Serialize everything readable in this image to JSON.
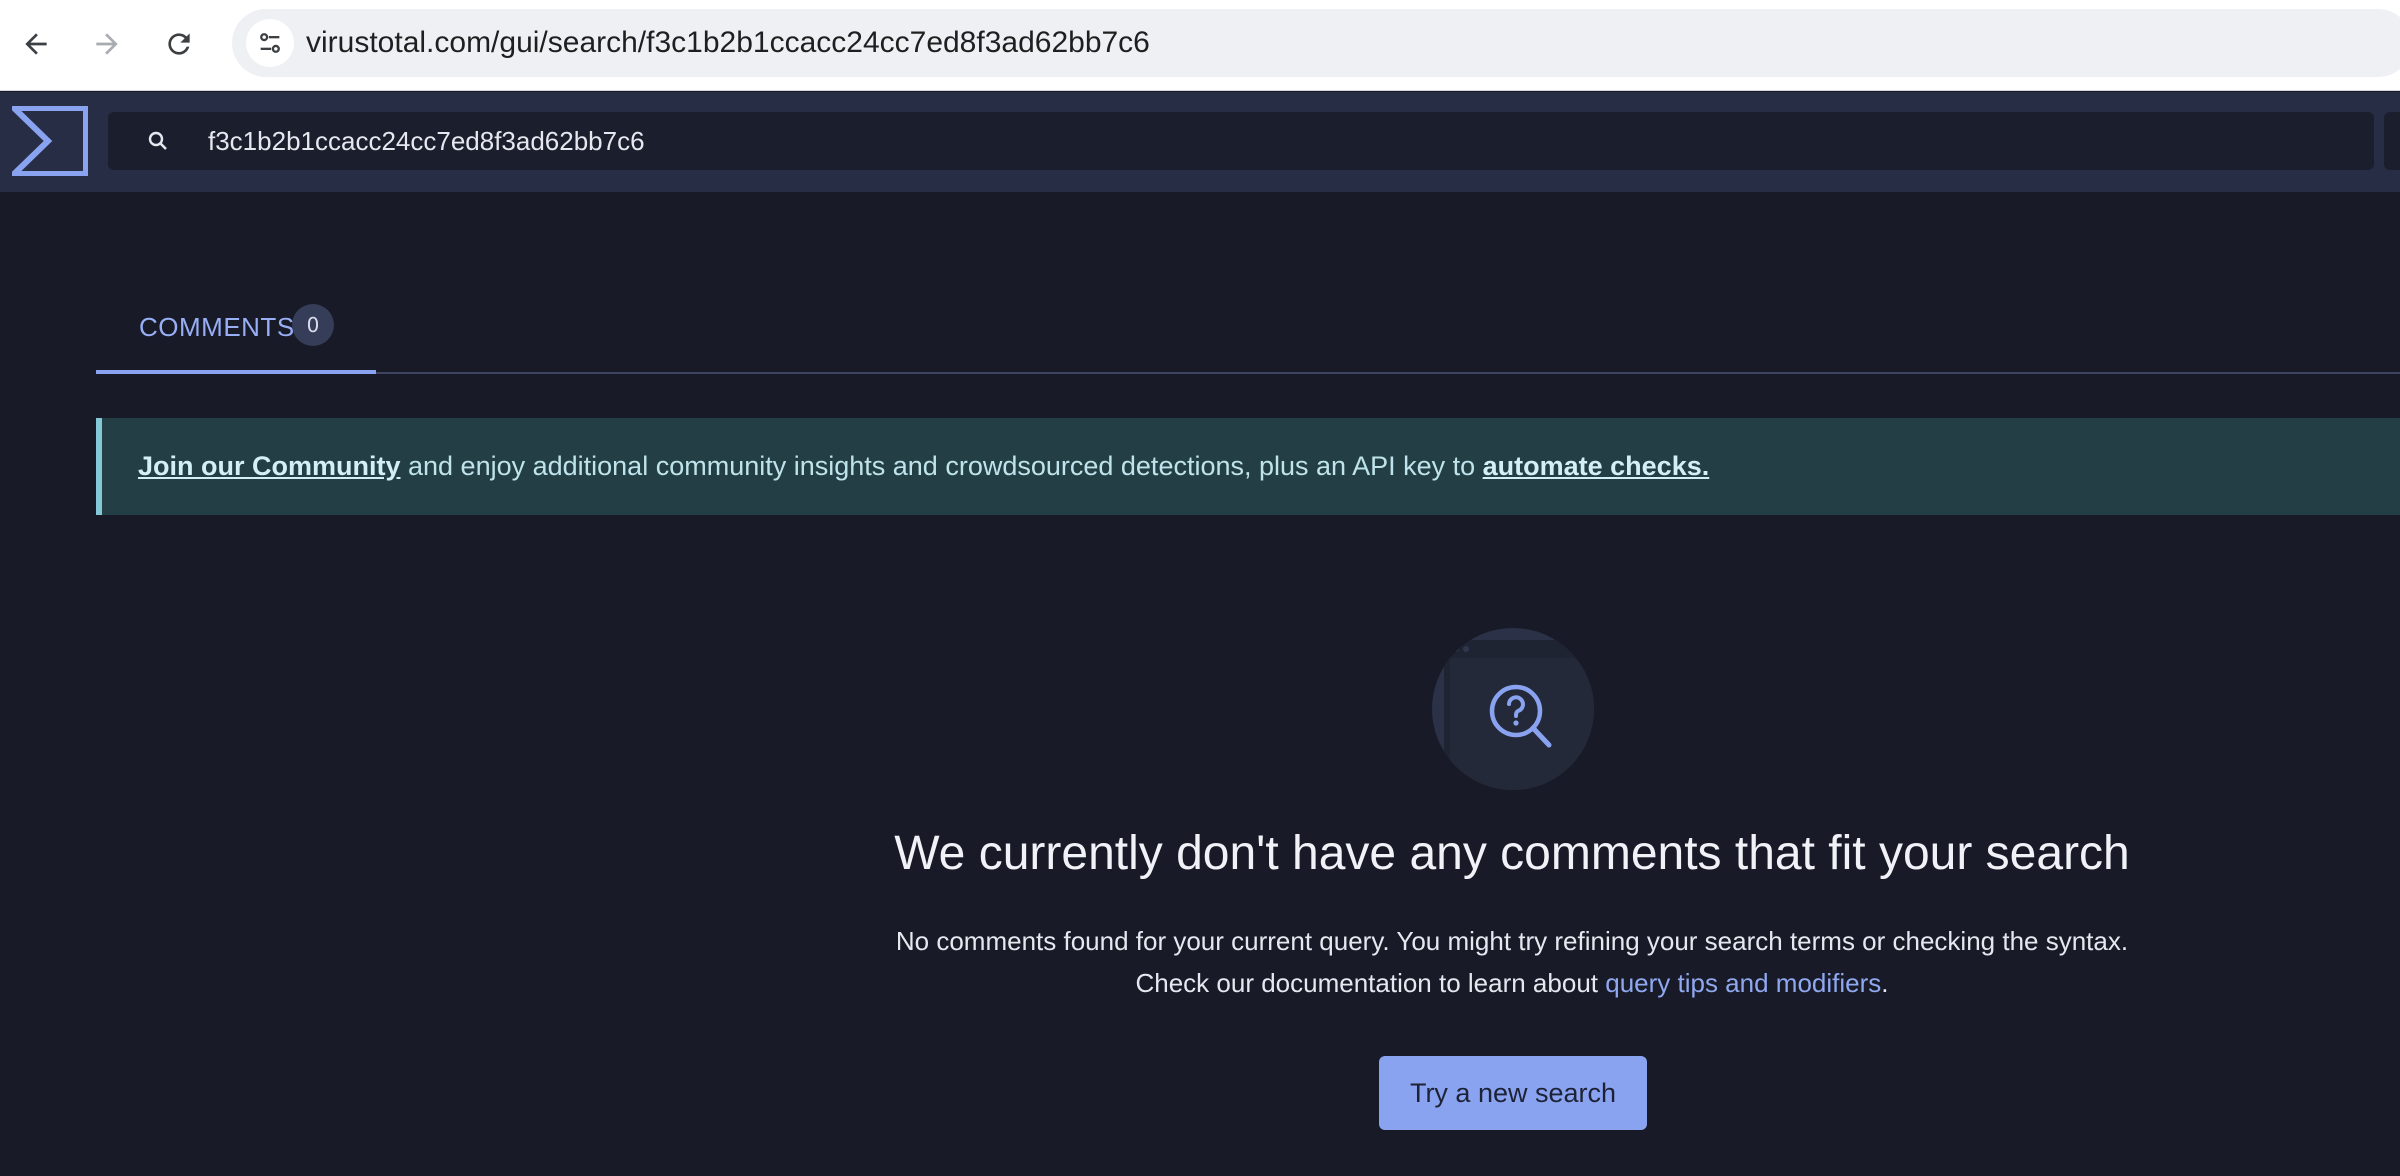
{
  "browser": {
    "url": "virustotal.com/gui/search/f3c1b2b1ccacc24cc7ed8f3ad62bb7c6"
  },
  "header": {
    "search_value": "f3c1b2b1ccacc24cc7ed8f3ad62bb7c6"
  },
  "tabs": [
    {
      "label": "COMMENTS",
      "count": "0"
    }
  ],
  "banner": {
    "link1": "Join our Community",
    "text": " and enjoy additional community insights and crowdsourced detections, plus an API key to ",
    "link2": "automate checks."
  },
  "empty_state": {
    "title": "We currently don't have any comments that fit your search",
    "line1": "No comments found for your current query. You might try refining your search terms or checking the syntax.",
    "line2_prefix": "Check our documentation to learn about ",
    "line2_link": "query tips and modifiers",
    "line2_suffix": ".",
    "button": "Try a new search"
  },
  "colors": {
    "background": "#181a27",
    "header": "#262d44",
    "accent": "#8aa3f0",
    "banner": "#233f45"
  }
}
